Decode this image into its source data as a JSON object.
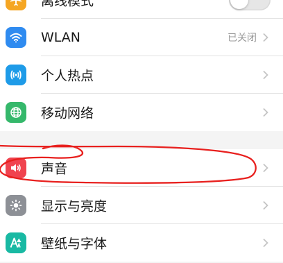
{
  "settings": {
    "group1": [
      {
        "label": "离线模式",
        "icon": "airplane-icon",
        "color": "#f5a623",
        "control": "toggle",
        "toggle_on": false
      },
      {
        "label": "WLAN",
        "icon": "wifi-icon",
        "color": "#2f8bf0",
        "value": "已关闭"
      },
      {
        "label": "个人热点",
        "icon": "hotspot-icon",
        "color": "#1e9be8"
      },
      {
        "label": "移动网络",
        "icon": "globe-icon",
        "color": "#35b86b"
      }
    ],
    "group2": [
      {
        "label": "声音",
        "icon": "speaker-icon",
        "color": "#f0434f"
      },
      {
        "label": "显示与亮度",
        "icon": "brightness-icon",
        "color": "#8d9096"
      },
      {
        "label": "壁纸与字体",
        "icon": "wallpaper-font-icon",
        "color": "#19b9a3"
      }
    ]
  },
  "annotation": {
    "color": "#e8201e"
  }
}
